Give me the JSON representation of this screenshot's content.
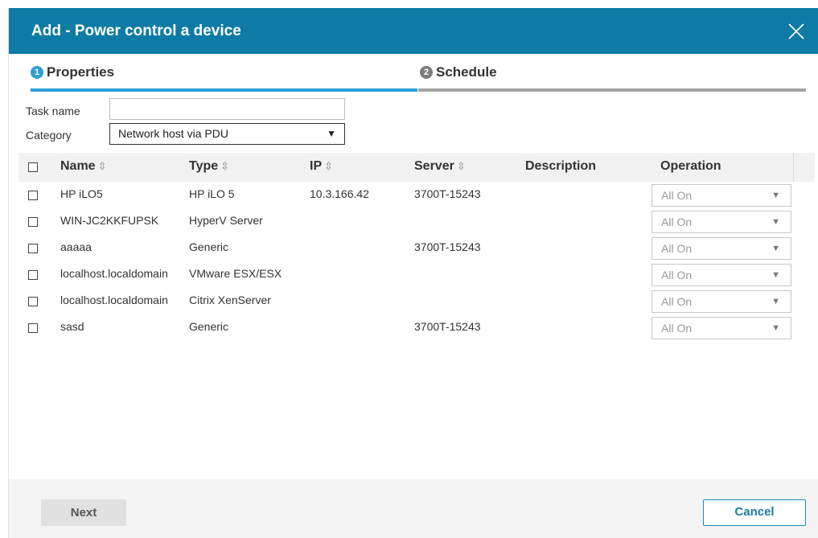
{
  "dialog": {
    "title": "Add - Power control a device",
    "close_icon": "close-icon"
  },
  "steps": [
    {
      "number": "1",
      "label": "Properties",
      "active": true,
      "color": "#2c9fd4"
    },
    {
      "number": "2",
      "label": "Schedule",
      "active": false,
      "color": "#a3a3a3"
    }
  ],
  "form": {
    "task_name_label": "Task name",
    "task_name_value": "",
    "category_label": "Category",
    "category_value": "Network host via PDU"
  },
  "table": {
    "columns": {
      "name": "Name",
      "type": "Type",
      "ip": "IP",
      "server": "Server",
      "description": "Description",
      "operation": "Operation"
    },
    "rows": [
      {
        "name": "HP iLO5",
        "type": "HP iLO 5",
        "ip": "10.3.166.42",
        "server": "3700T-15243",
        "description": "",
        "operation": "All On"
      },
      {
        "name": "WIN-JC2KKFUPSK",
        "type": "HyperV Server",
        "ip": "",
        "server": "",
        "description": "",
        "operation": "All On"
      },
      {
        "name": "aaaaa",
        "type": "Generic",
        "ip": "",
        "server": "3700T-15243",
        "description": "",
        "operation": "All On"
      },
      {
        "name": "localhost.localdomain",
        "type": "VMware ESX/ESX",
        "ip": "",
        "server": "",
        "description": "",
        "operation": "All On"
      },
      {
        "name": "localhost.localdomain",
        "type": "Citrix XenServer",
        "ip": "",
        "server": "",
        "description": "",
        "operation": "All On"
      },
      {
        "name": "sasd",
        "type": "Generic",
        "ip": "",
        "server": "3700T-15243",
        "description": "",
        "operation": "All On"
      }
    ]
  },
  "footer": {
    "next_label": "Next",
    "cancel_label": "Cancel"
  },
  "colors": {
    "header": "#0e7ba6",
    "accent": "#2c9fd4"
  }
}
